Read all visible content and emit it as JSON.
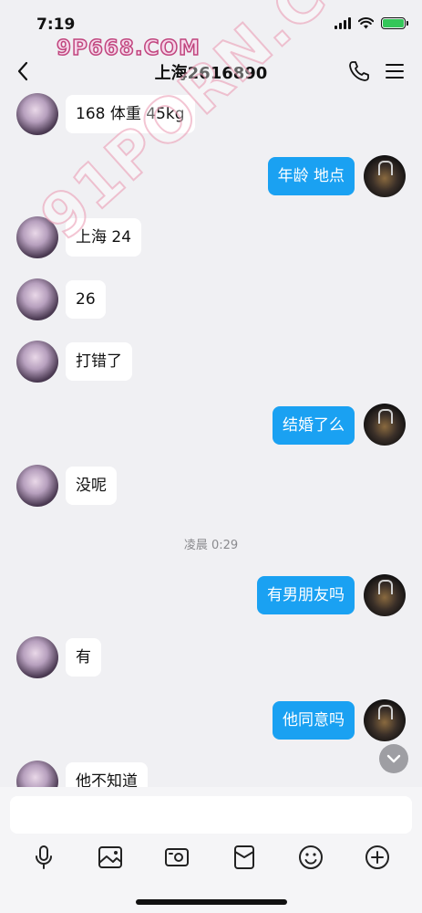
{
  "status": {
    "time": "7:19",
    "battery_level": 1.0,
    "battery_color": "#34c759",
    "icons": [
      "signal-icon",
      "wifi-icon",
      "battery-icon"
    ]
  },
  "watermarks": {
    "top": "9P668.COM",
    "diagonal": "91PORN.COM"
  },
  "nav": {
    "title": "上海2616890",
    "icons": [
      "back-icon",
      "phone-icon",
      "menu-icon"
    ]
  },
  "messages": [
    {
      "side": "left",
      "text": "168 体重 45kg"
    },
    {
      "side": "right",
      "text": "年龄 地点"
    },
    {
      "side": "left",
      "text": "上海 24"
    },
    {
      "side": "left",
      "text": "26"
    },
    {
      "side": "left",
      "text": "打错了"
    },
    {
      "side": "right",
      "text": "结婚了么"
    },
    {
      "side": "left",
      "text": "没呢"
    },
    {
      "side": "time",
      "text": "凌晨 0:29"
    },
    {
      "side": "right",
      "text": "有男朋友吗"
    },
    {
      "side": "left",
      "text": "有"
    },
    {
      "side": "right",
      "text": "他同意吗"
    },
    {
      "side": "left",
      "text": "他不知道"
    }
  ],
  "colors": {
    "background": "#f0f0f3",
    "outgoing_bubble": "#1aa1f2",
    "incoming_bubble": "#ffffff"
  },
  "input": {
    "value": "",
    "placeholder": ""
  },
  "toolbar": {
    "icons": [
      "microphone-icon",
      "image-icon",
      "video-icon",
      "red-packet-icon",
      "emoji-icon",
      "plus-icon"
    ]
  }
}
